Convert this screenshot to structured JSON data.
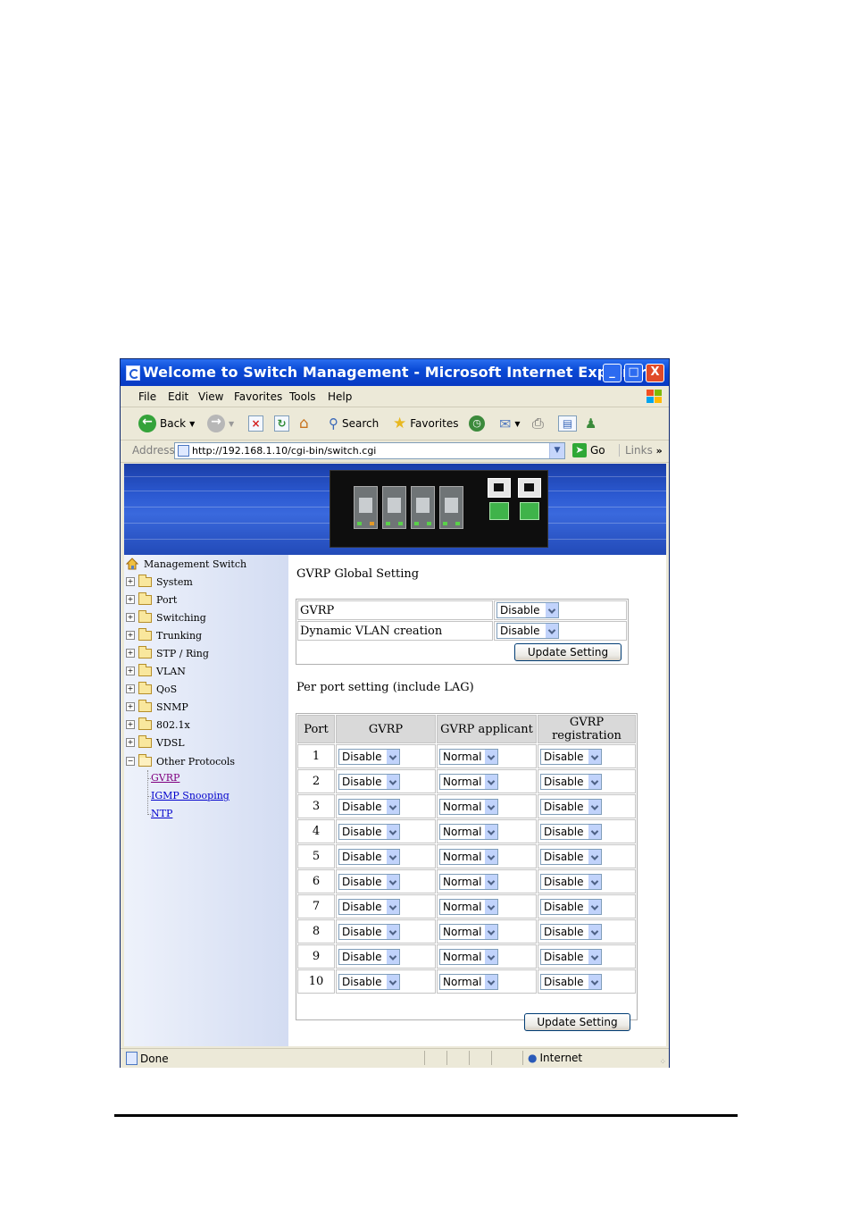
{
  "window": {
    "title": "Welcome to Switch Management - Microsoft Internet Explorer",
    "controls": {
      "minimize": "_",
      "maximize": "□",
      "close": "X"
    }
  },
  "menubar": {
    "items": [
      "File",
      "Edit",
      "View",
      "Favorites",
      "Tools",
      "Help"
    ]
  },
  "toolbar": {
    "back_label": "Back",
    "search_label": "Search",
    "favorites_label": "Favorites"
  },
  "addressbar": {
    "label": "Address",
    "url": "http://192.168.1.10/cgi-bin/switch.cgi",
    "go_label": "Go",
    "links_label": "Links",
    "chevron": "»"
  },
  "sidebar": {
    "root": "Management Switch",
    "items": [
      "System",
      "Port",
      "Switching",
      "Trunking",
      "STP / Ring",
      "VLAN",
      "QoS",
      "SNMP",
      "802.1x",
      "VDSL",
      "Other Protocols"
    ],
    "subitems": [
      "GVRP",
      "IGMP Snooping",
      "NTP"
    ]
  },
  "global": {
    "heading": "GVRP Global Setting",
    "rows": [
      {
        "label": "GVRP",
        "value": "Disable"
      },
      {
        "label": "Dynamic VLAN creation",
        "value": "Disable"
      }
    ],
    "update_label": "Update Setting"
  },
  "perport": {
    "heading": "Per port setting (include LAG)",
    "headers": [
      "Port",
      "GVRP",
      "GVRP applicant",
      "GVRP registration"
    ],
    "rows": [
      {
        "port": "1",
        "gvrp": "Disable",
        "applicant": "Normal",
        "registration": "Disable"
      },
      {
        "port": "2",
        "gvrp": "Disable",
        "applicant": "Normal",
        "registration": "Disable"
      },
      {
        "port": "3",
        "gvrp": "Disable",
        "applicant": "Normal",
        "registration": "Disable"
      },
      {
        "port": "4",
        "gvrp": "Disable",
        "applicant": "Normal",
        "registration": "Disable"
      },
      {
        "port": "5",
        "gvrp": "Disable",
        "applicant": "Normal",
        "registration": "Disable"
      },
      {
        "port": "6",
        "gvrp": "Disable",
        "applicant": "Normal",
        "registration": "Disable"
      },
      {
        "port": "7",
        "gvrp": "Disable",
        "applicant": "Normal",
        "registration": "Disable"
      },
      {
        "port": "8",
        "gvrp": "Disable",
        "applicant": "Normal",
        "registration": "Disable"
      },
      {
        "port": "9",
        "gvrp": "Disable",
        "applicant": "Normal",
        "registration": "Disable"
      },
      {
        "port": "10",
        "gvrp": "Disable",
        "applicant": "Normal",
        "registration": "Disable"
      }
    ],
    "update_label": "Update Setting"
  },
  "statusbar": {
    "status": "Done",
    "zone": "Internet"
  },
  "colors": {
    "titlebar": "#0a4ad6",
    "banner": "#2c5ad2",
    "close_button": "#e04a28",
    "link": "#0000cc",
    "visited_link": "#800080"
  }
}
